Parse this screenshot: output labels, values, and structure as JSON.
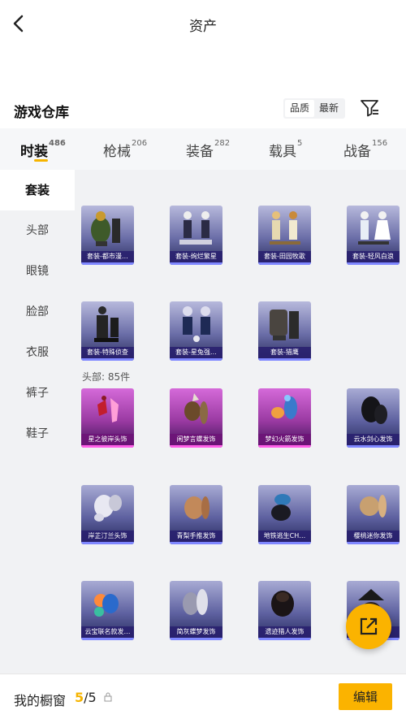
{
  "header": {
    "title": "资产"
  },
  "warehouse": {
    "title": "游戏仓库",
    "sort_options": [
      "品质",
      "最新"
    ]
  },
  "tabs": [
    {
      "label": "时装",
      "count": "486"
    },
    {
      "label": "枪械",
      "count": "206"
    },
    {
      "label": "装备",
      "count": "282"
    },
    {
      "label": "载具",
      "count": "5"
    },
    {
      "label": "战备",
      "count": "156"
    }
  ],
  "sidebar": {
    "items": [
      "套装",
      "头部",
      "眼镜",
      "脸部",
      "衣服",
      "裤子",
      "鞋子"
    ]
  },
  "suits": [
    {
      "name": "套装-都市漫…",
      "icon": "suit-urban-icon"
    },
    {
      "name": "套装-绚烂繁星",
      "icon": "suit-star-icon"
    },
    {
      "name": "套装-田园牧歌",
      "icon": "suit-pastoral-icon"
    },
    {
      "name": "套装-轻风白浪",
      "icon": "suit-breeze-icon"
    },
    {
      "name": "套装-特殊侦查",
      "icon": "suit-recon-icon"
    },
    {
      "name": "套装-星兔强…",
      "icon": "suit-rabbit-icon"
    },
    {
      "name": "套装-猎鹰",
      "icon": "suit-falcon-icon"
    }
  ],
  "head_section": {
    "label": "头部: 85件"
  },
  "head_items": [
    {
      "name": "星之彼岸头饰",
      "rarity": "purple"
    },
    {
      "name": "闲梦言蝶发饰",
      "rarity": "purple"
    },
    {
      "name": "梦幻火箭发饰",
      "rarity": "purple"
    },
    {
      "name": "云水剑心发饰",
      "rarity": "blue"
    },
    {
      "name": "岸芷汀兰头饰",
      "rarity": "blue"
    },
    {
      "name": "青梨手推发饰",
      "rarity": "blue"
    },
    {
      "name": "地铁逃生CH…",
      "rarity": "blue"
    },
    {
      "name": "樱桃迷你发饰",
      "rarity": "blue"
    },
    {
      "name": "云宝联名款发…",
      "rarity": "blue"
    },
    {
      "name": "简灰蝶梦发饰",
      "rarity": "blue"
    },
    {
      "name": "遗迹猎人发饰",
      "rarity": "blue"
    },
    {
      "name": "",
      "rarity": "blue"
    }
  ],
  "cabinet": {
    "label": "我的橱窗",
    "current": "5",
    "total": "/5",
    "edit_label": "编辑"
  },
  "colors": {
    "accent": "#fbb300",
    "purple_rarity": "#ff5fe8",
    "blue_rarity": "#7f87ff"
  }
}
